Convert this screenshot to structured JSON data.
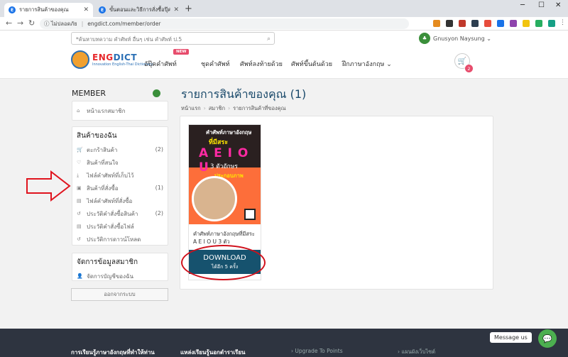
{
  "browser": {
    "tabs": [
      {
        "title": "รายการสินค้าของคุณ",
        "active": true
      },
      {
        "title": "ขั้นตอนและวิธีการสั่งซื้อปุ๊ค",
        "active": false
      }
    ],
    "new_tab": "+",
    "window_controls": [
      "─",
      "☐",
      "✕"
    ],
    "security": "ไม่ปลอดภัย",
    "url": "engdict.com/member/order"
  },
  "header": {
    "search_placeholder": "*ค้นหาบทความ คำศัพท์ อื่นๆ เช่น คำศัพท์ ป.5",
    "user_name": "Gnusyon Naysung",
    "logo_brand_a": "ENG",
    "logo_brand_b": "DICT",
    "logo_sub": "Innovation English-Thai Dictionary",
    "menu": [
      {
        "label": "อัปุ๊คคำศัพท์"
      },
      {
        "label": "ชุดคำศัพท์"
      },
      {
        "label": "ศัพท์ลงท้ายด้วย"
      },
      {
        "label": "ศัพท์ขึ้นต้นด้วย"
      },
      {
        "label": "ฝึกภาษาอังกฤษ"
      }
    ],
    "new_badge": "NEW",
    "cart_count": "2"
  },
  "sidebar": {
    "member_title": "MEMBER",
    "home_link": "หน้าแรกสมาชิก",
    "my_products_title": "สินค้าของฉัน",
    "items": [
      {
        "label": "ตะกร้าสินค้า",
        "count": "(2)",
        "icon": "cart-icon"
      },
      {
        "label": "สินค้าที่สนใจ",
        "count": "",
        "icon": "heart-icon"
      },
      {
        "label": "ไฟล์คำศัพท์ที่เก็บไว้",
        "count": "",
        "icon": "download-icon"
      },
      {
        "label": "สินค้าที่สั่งซื้อ",
        "count": "(1)",
        "icon": "bag-icon"
      },
      {
        "label": "ไฟล์คำศัพท์ที่สั่งซื้อ",
        "count": "",
        "icon": "file-icon"
      },
      {
        "label": "ประวัติคำสั่งซื้อสินค้า",
        "count": "(2)",
        "icon": "history-icon"
      },
      {
        "label": "ประวัติคำสั่งซื้อไฟล์",
        "count": "",
        "icon": "file-icon"
      },
      {
        "label": "ประวัติการดาวน์โหลด",
        "count": "",
        "icon": "history-icon"
      }
    ],
    "manage_title": "จัดการข้อมูลสมาชิก",
    "manage_item": "จัดการบัญชีของฉัน",
    "logout": "ออกจากระบบ"
  },
  "main": {
    "title": "รายการสินค้าของคุณ (1)",
    "breadcrumb": [
      "หน้าแรก",
      "สมาชิก",
      "รายการสินค้าที่ของคุณ"
    ],
    "product": {
      "cover_line1": "คำศัพท์ภาษาอังกฤษ",
      "cover_line2": "ที่มีสระ",
      "cover_line3": "A E I O U",
      "cover_line4": "3 ตัวอักษร",
      "cover_line5": "ประกอบภาพ",
      "name": "คำศัพท์ภาษาอังกฤษที่มีสระ A E I O U 3 ตัว",
      "download_label": "DOWNLOAD",
      "download_remaining": "ได้อีก 5 ครั้ง"
    }
  },
  "footer": {
    "col1": "การเรียนรู้ภาษาอังกฤษที่ทำให้ท่าน",
    "col2": "แหล่งเรียนรู้นอกตำราเรียน",
    "col3": "Upgrade To Points",
    "col4": "แผนผังเว็บไซต์",
    "message_us": "Message us"
  }
}
